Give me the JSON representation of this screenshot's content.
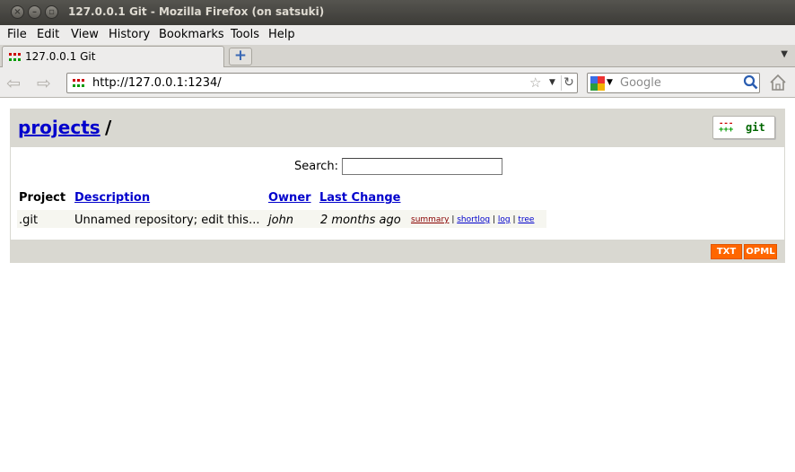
{
  "window": {
    "title": "127.0.0.1 Git - Mozilla Firefox (on satsuki)"
  },
  "menu": [
    "File",
    "Edit",
    "View",
    "History",
    "Bookmarks",
    "Tools",
    "Help"
  ],
  "tab": {
    "label": "127.0.0.1 Git",
    "new_tab_symbol": "+"
  },
  "nav": {
    "url": "http://127.0.0.1:1234/",
    "search_placeholder": "Google"
  },
  "page": {
    "breadcrumb_link": "projects",
    "breadcrumb_sep": "/",
    "logo_text": "git",
    "search_label": "Search:",
    "search_value": "",
    "table": {
      "headers": [
        "Project",
        "Description",
        "Owner",
        "Last Change"
      ],
      "rows": [
        {
          "project": ".git",
          "description": "Unnamed repository; edit this...",
          "owner": "john",
          "last_change": "2 months ago",
          "links": [
            "summary",
            "shortlog",
            "log",
            "tree"
          ]
        }
      ]
    },
    "footer_badges": [
      "TXT",
      "OPML"
    ]
  },
  "colors": {
    "link": "#0000cc",
    "header_bg": "#d9d8d1",
    "badge": "#ff6600"
  }
}
